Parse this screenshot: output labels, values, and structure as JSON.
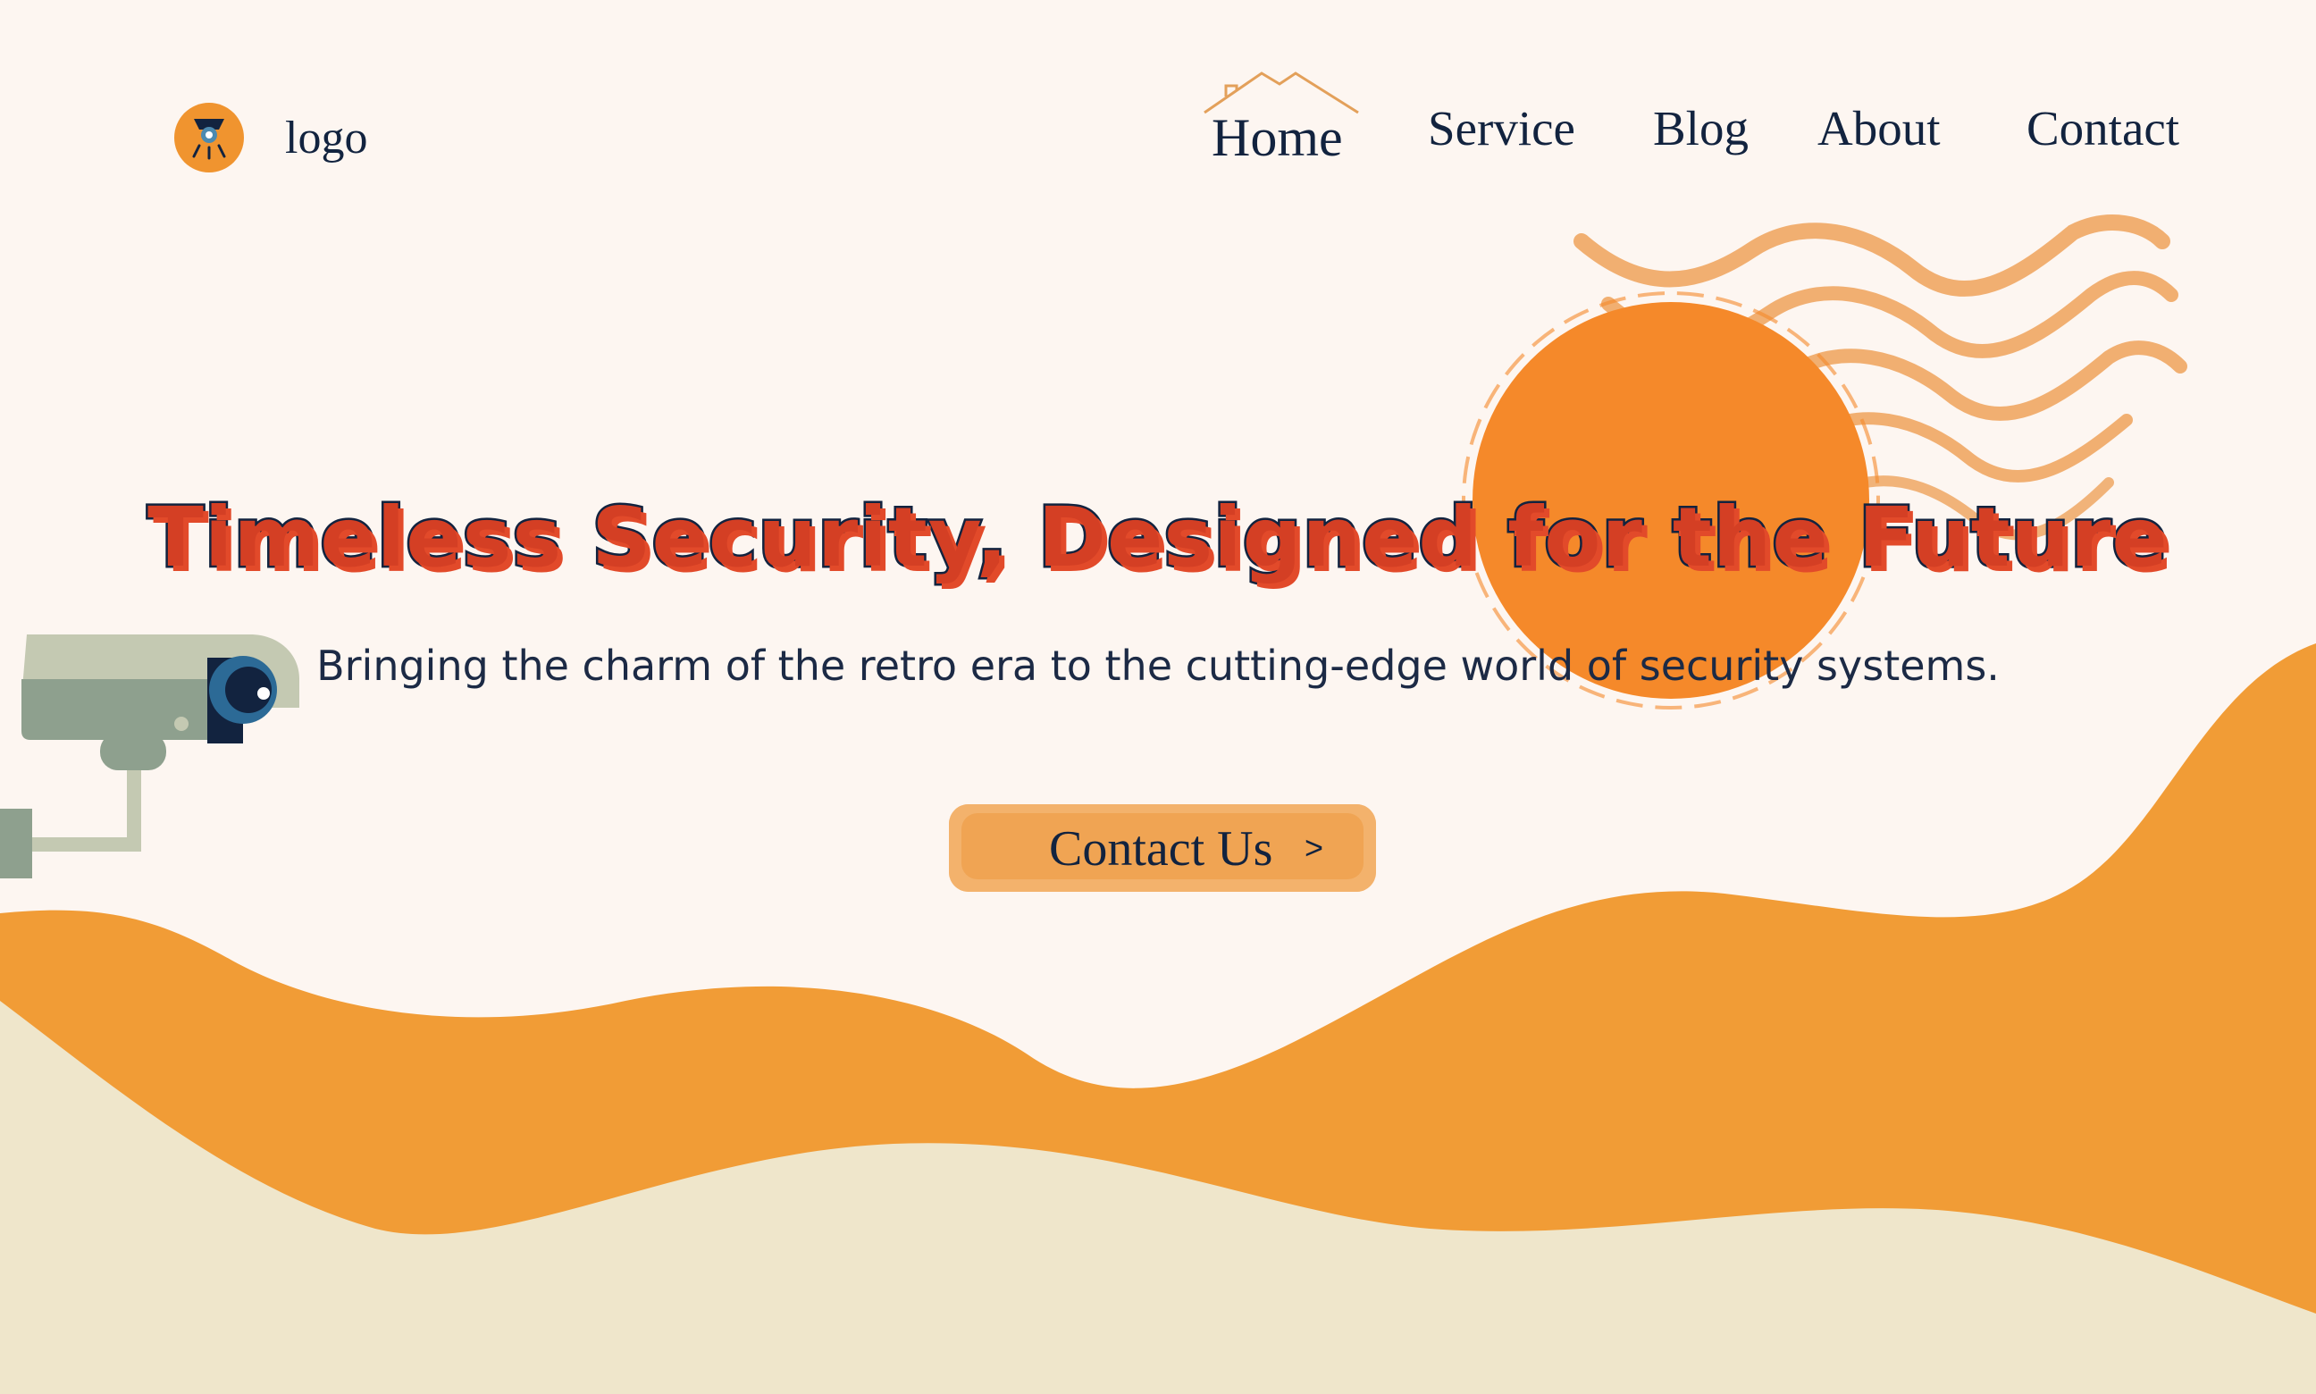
{
  "header": {
    "logo_text": "logo",
    "logo_icon": "security-camera-icon"
  },
  "nav": {
    "items": [
      {
        "label": "Home",
        "active": true
      },
      {
        "label": "Service"
      },
      {
        "label": "Blog"
      },
      {
        "label": "About"
      },
      {
        "label": "Contact"
      }
    ]
  },
  "hero": {
    "title": "Timeless Security, Designed for the Future",
    "subtitle": "Bringing the charm of the retro era to the cutting-edge world of security systems.",
    "cta_label": "Contact Us",
    "cta_arrow": ">"
  },
  "colors": {
    "background": "#fdf6f1",
    "accent_orange": "#f19c36",
    "sun_orange": "#f5892a",
    "title_red": "#d43f24",
    "navy": "#12233f",
    "sand": "#efe6cb"
  }
}
